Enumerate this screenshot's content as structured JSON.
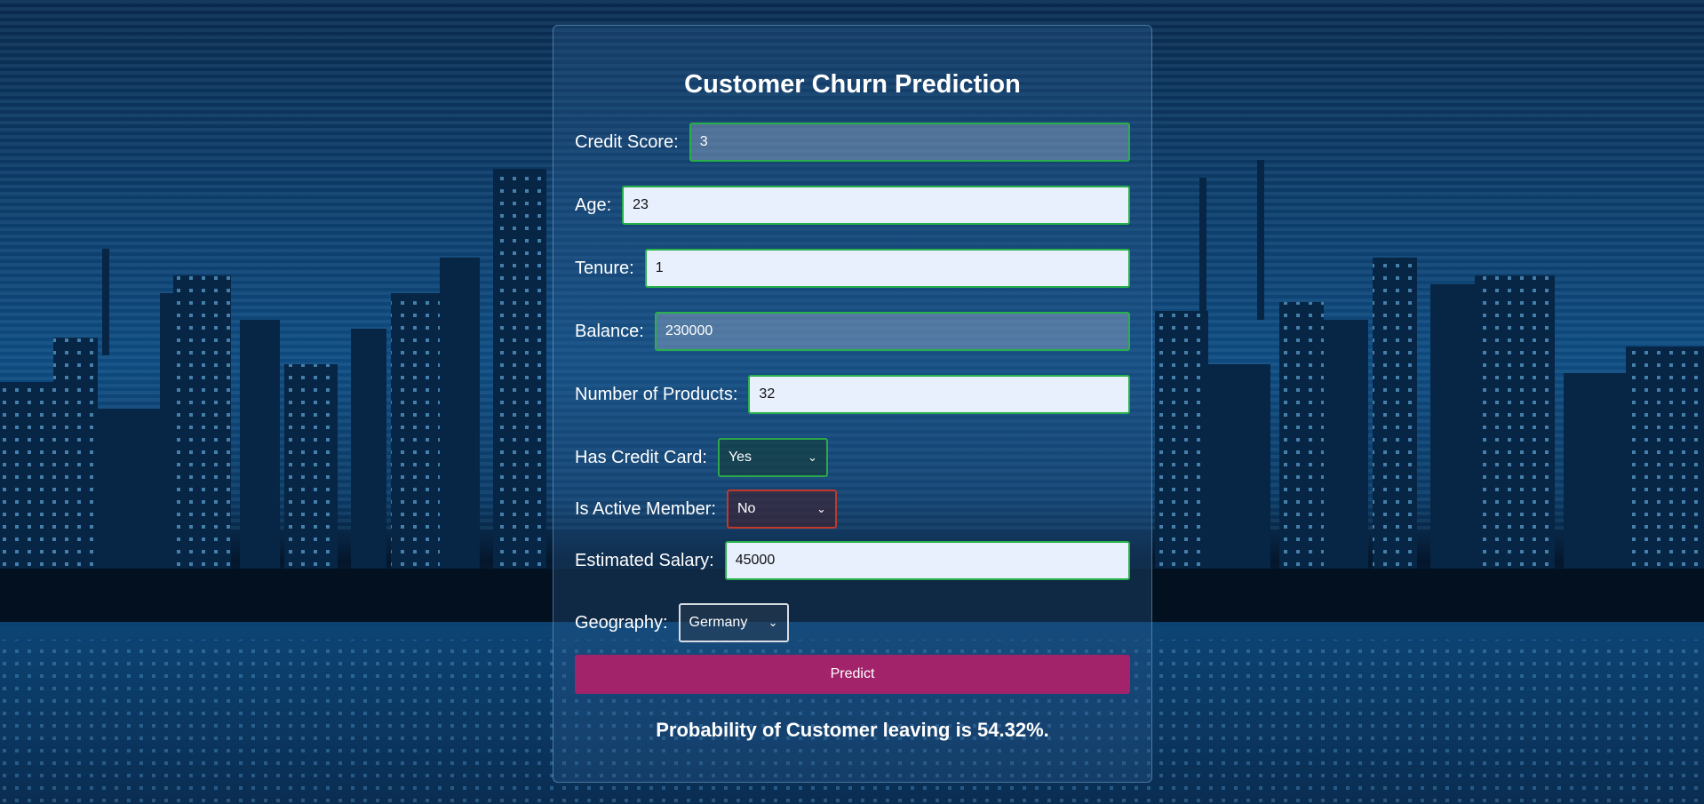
{
  "page": {
    "title": "Customer Churn Prediction"
  },
  "form": {
    "credit_score": {
      "label": "Credit Score:",
      "value": "3"
    },
    "age": {
      "label": "Age:",
      "value": "23"
    },
    "tenure": {
      "label": "Tenure:",
      "value": "1"
    },
    "balance": {
      "label": "Balance:",
      "value": "230000"
    },
    "num_products": {
      "label": "Number of Products:",
      "value": "32"
    },
    "has_credit_card": {
      "label": "Has Credit Card:",
      "selected": "Yes"
    },
    "is_active_member": {
      "label": "Is Active Member:",
      "selected": "No"
    },
    "estimated_salary": {
      "label": "Estimated Salary:",
      "value": "45000"
    },
    "geography": {
      "label": "Geography:",
      "selected": "Germany"
    }
  },
  "predict_button": {
    "label": "Predict"
  },
  "result": {
    "text": "Probability of Customer leaving is 54.32%."
  },
  "colors": {
    "valid_border": "#28b04a",
    "invalid_border": "#c0392b",
    "predict_button": "#a3236a",
    "input_background": "#e8effd"
  },
  "icons": {
    "select_arrow": "chevron-down-icon",
    "background": "city-skyline-background"
  }
}
